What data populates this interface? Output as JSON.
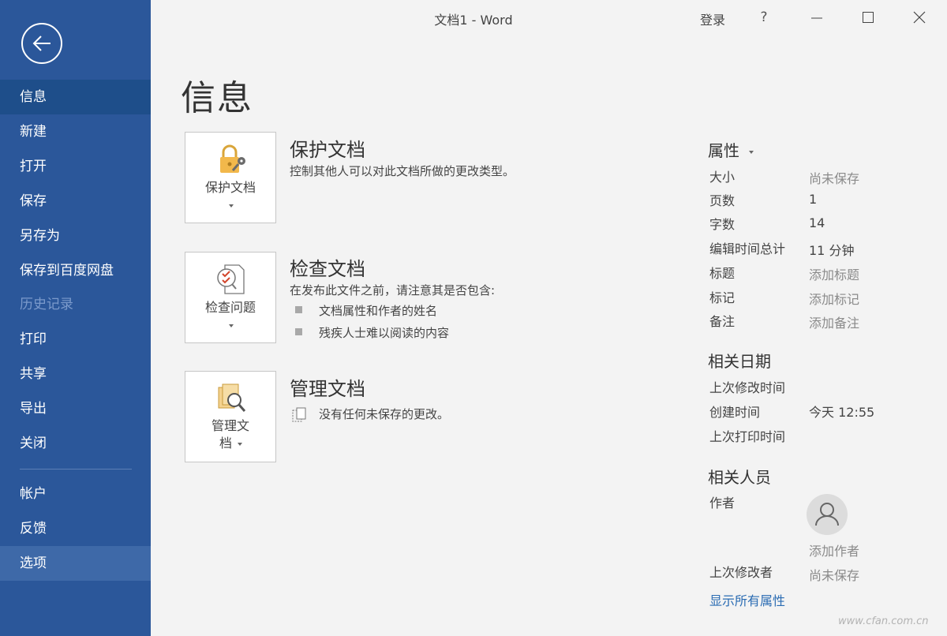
{
  "titlebar": {
    "doc_title": "文档1  -  Word",
    "sign_in": "登录",
    "help": "?"
  },
  "sidebar": {
    "items": [
      {
        "label": "信息",
        "state": "selected"
      },
      {
        "label": "新建"
      },
      {
        "label": "打开"
      },
      {
        "label": "保存"
      },
      {
        "label": "另存为"
      },
      {
        "label": "保存到百度网盘"
      },
      {
        "label": "历史记录",
        "state": "disabled"
      },
      {
        "label": "打印"
      },
      {
        "label": "共享"
      },
      {
        "label": "导出"
      },
      {
        "label": "关闭"
      },
      {
        "label": "帐户"
      },
      {
        "label": "反馈"
      },
      {
        "label": "选项",
        "state": "hover"
      }
    ]
  },
  "page": {
    "title": "信息"
  },
  "sections": {
    "protect": {
      "tile_label": "保护文档",
      "title": "保护文档",
      "desc": "控制其他人可以对此文档所做的更改类型。"
    },
    "inspect": {
      "tile_label": "检查问题",
      "title": "检查文档",
      "desc": "在发布此文件之前，请注意其是否包含:",
      "bullets": [
        "文档属性和作者的姓名",
        "残疾人士难以阅读的内容"
      ]
    },
    "manage": {
      "tile_label_line1": "管理文",
      "tile_label_line2": "档",
      "title": "管理文档",
      "desc": "没有任何未保存的更改。"
    }
  },
  "properties": {
    "header": "属性",
    "rows": [
      {
        "label": "大小",
        "value": "尚未保存"
      },
      {
        "label": "页数",
        "value": "1"
      },
      {
        "label": "字数",
        "value": "14"
      },
      {
        "label": "编辑时间总计",
        "value": "11 分钟"
      },
      {
        "label": "标题",
        "value": "添加标题"
      },
      {
        "label": "标记",
        "value": "添加标记"
      },
      {
        "label": "备注",
        "value": "添加备注"
      }
    ],
    "dates_header": "相关日期",
    "dates": [
      {
        "label": "上次修改时间",
        "value": ""
      },
      {
        "label": "创建时间",
        "value": "今天 12:55"
      },
      {
        "label": "上次打印时间",
        "value": ""
      }
    ],
    "people_header": "相关人员",
    "author_label": "作者",
    "add_author": "添加作者",
    "last_modified_by_label": "上次修改者",
    "last_modified_by_value": "尚未保存",
    "show_all": "显示所有属性"
  },
  "watermark": "www.cfan.com.cn",
  "colors": {
    "sidebar": "#2b579a",
    "sidebar_selected": "#1e4e8a",
    "link": "#2b6cb3"
  },
  "icons": [
    "back-arrow-icon",
    "lock-key-icon",
    "inspect-document-icon",
    "manage-versions-icon",
    "document-copy-icon",
    "person-icon"
  ]
}
